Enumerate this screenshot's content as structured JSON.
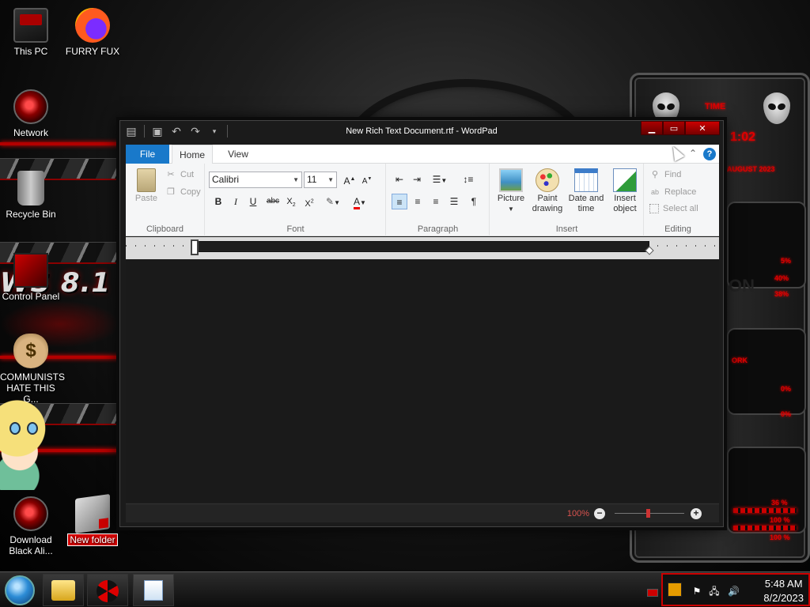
{
  "desktop": {
    "icons": [
      {
        "label": "This PC"
      },
      {
        "label": "FURRY FUX"
      },
      {
        "label": "Network"
      },
      {
        "label": "Recycle Bin"
      },
      {
        "label": "Control Panel"
      },
      {
        "label": "COMMUNISTS HATE THIS G..."
      },
      {
        "label": "Download Black Ali..."
      },
      {
        "label": "New folder"
      }
    ],
    "wallpaper_text": "WS 8.1 BL"
  },
  "gadget": {
    "header": "TIME",
    "time_digits": "1:02",
    "date_text": "AUGUST 2023",
    "readouts": [
      "5%",
      "40%",
      "38%",
      "0%",
      "0%",
      "36 %",
      "100 %",
      "100 %"
    ],
    "panel_words": [
      "ON",
      "ORK"
    ]
  },
  "window": {
    "title": "New Rich Text Document.rtf - WordPad",
    "tabs": {
      "file": "File",
      "home": "Home",
      "view": "View"
    },
    "clipboard": {
      "paste": "Paste",
      "cut": "Cut",
      "copy": "Copy",
      "label": "Clipboard"
    },
    "font": {
      "family": "Calibri",
      "size": "11",
      "label": "Font"
    },
    "paragraph": {
      "label": "Paragraph"
    },
    "insert": {
      "picture": "Picture",
      "paint1": "Paint",
      "paint2": "drawing",
      "dt1": "Date and",
      "dt2": "time",
      "obj1": "Insert",
      "obj2": "object",
      "label": "Insert"
    },
    "editing": {
      "find": "Find",
      "replace": "Replace",
      "select_all": "Select all",
      "label": "Editing"
    },
    "status": {
      "zoom": "100%"
    }
  },
  "taskbar": {
    "time": "5:48 AM",
    "date": "8/2/2023"
  },
  "colors": {
    "accent": "#1979ca",
    "danger": "#cc0000"
  }
}
